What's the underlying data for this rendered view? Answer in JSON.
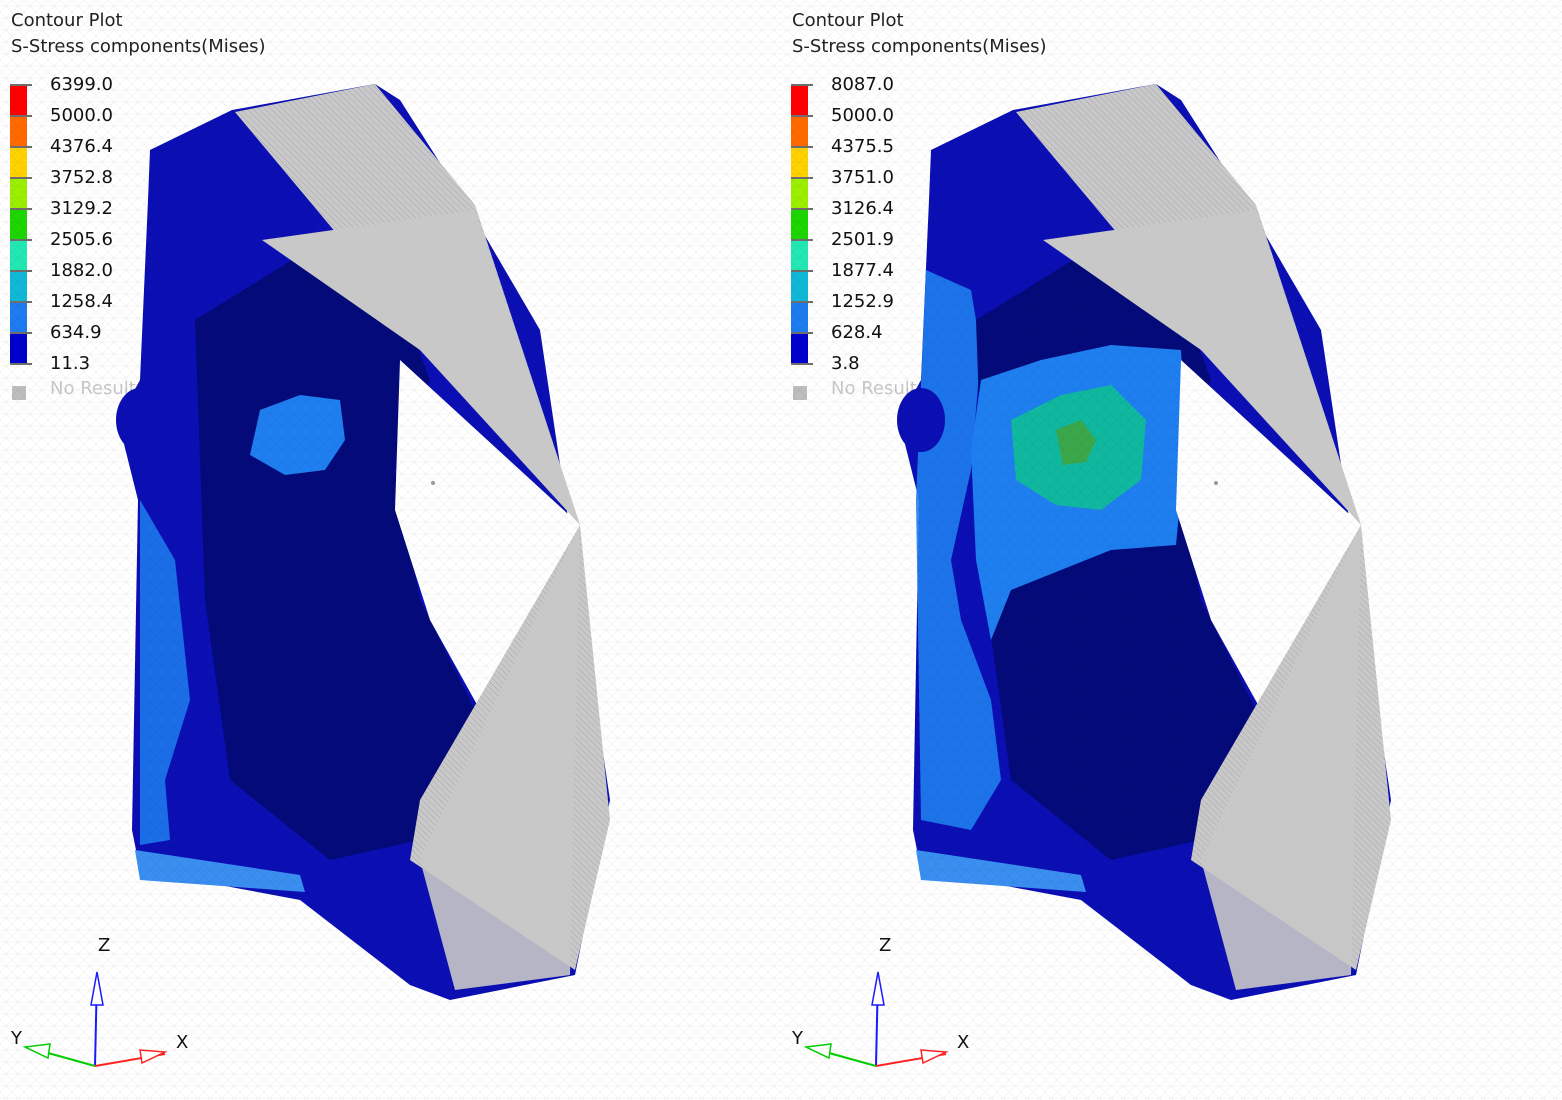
{
  "plots": [
    {
      "title": "Contour Plot",
      "subtitle": "S-Stress components(Mises)",
      "legend": {
        "values": [
          "6399.0",
          "5000.0",
          "4376.4",
          "3752.8",
          "3129.2",
          "2505.6",
          "1882.0",
          "1258.4",
          "634.9",
          "11.3"
        ],
        "no_result": "No Result"
      },
      "hotspot": "low"
    },
    {
      "title": "Contour Plot",
      "subtitle": "S-Stress components(Mises)",
      "legend": {
        "values": [
          "8087.0",
          "5000.0",
          "4375.5",
          "3751.0",
          "3126.4",
          "2501.9",
          "1877.4",
          "1252.9",
          "628.4",
          "3.8"
        ],
        "no_result": "No Result"
      },
      "hotspot": "high"
    }
  ],
  "legend_colors": [
    "#ff0000",
    "#ff6a00",
    "#ffd200",
    "#9cef00",
    "#1ed600",
    "#22e8b4",
    "#10b8d8",
    "#1e7cf0",
    "#0000cc"
  ],
  "triad": {
    "z": "Z",
    "y": "Y",
    "x": "X"
  },
  "colors": {
    "mesh_base": "#0b0fb4",
    "mesh_dark": "#040a7a",
    "mesh_light": "#1f7ff0",
    "rigid_elements": "#c8c8c8",
    "no_result": "#bdbdbd"
  }
}
